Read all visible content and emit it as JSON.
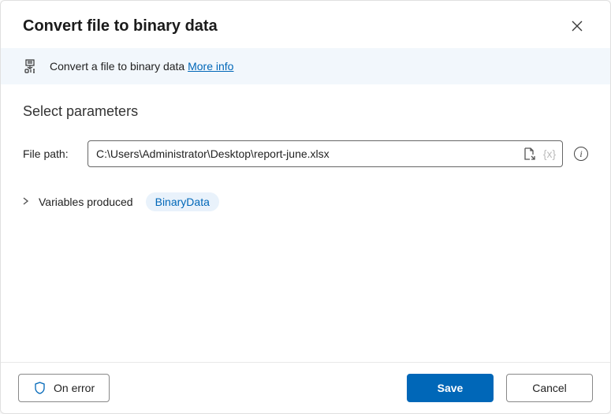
{
  "header": {
    "title": "Convert file to binary data"
  },
  "info": {
    "text": "Convert a file to binary data ",
    "link": "More info"
  },
  "params": {
    "section_title": "Select parameters",
    "file_path_label": "File path:",
    "file_path_value": "C:\\Users\\Administrator\\Desktop\\report-june.xlsx",
    "var_token": "{x}"
  },
  "variables": {
    "label": "Variables produced",
    "chip": "BinaryData"
  },
  "footer": {
    "on_error": "On error",
    "save": "Save",
    "cancel": "Cancel"
  }
}
